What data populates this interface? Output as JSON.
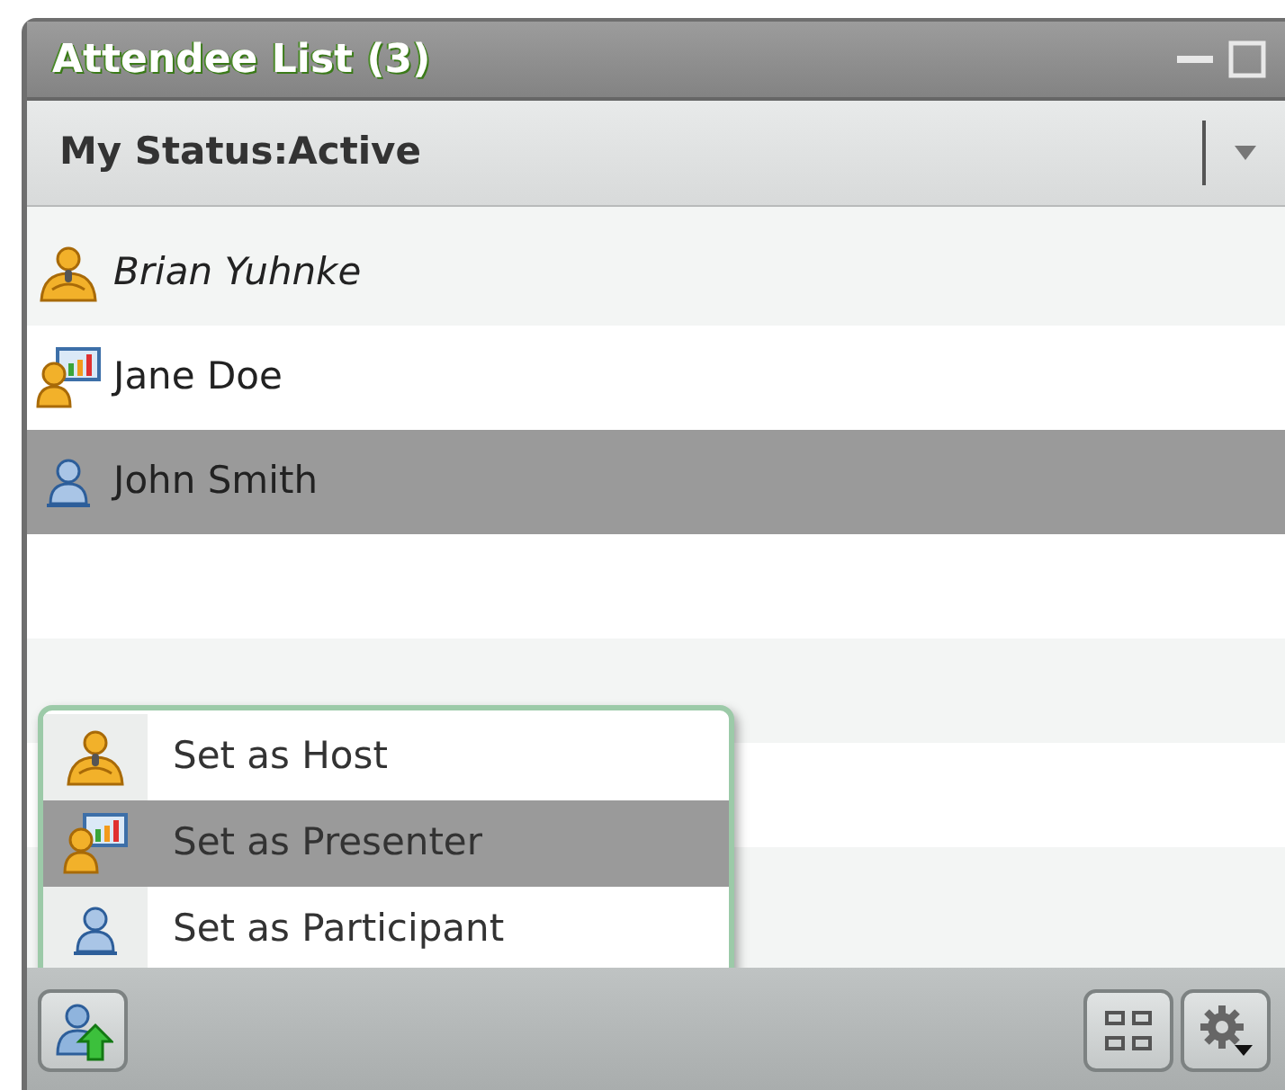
{
  "window": {
    "title": "Attendee List (3)"
  },
  "status": {
    "label": "My Status:Active"
  },
  "attendees": [
    {
      "name": "Brian Yuhnke",
      "kind": "host",
      "current_user": true,
      "selected": false
    },
    {
      "name": "Jane Doe",
      "kind": "presenter",
      "current_user": false,
      "selected": false
    },
    {
      "name": "John Smith",
      "kind": "participant",
      "current_user": false,
      "selected": true
    }
  ],
  "role_menu": [
    {
      "label": "Set as Host",
      "kind": "host",
      "selected": false
    },
    {
      "label": "Set as Presenter",
      "kind": "presenter",
      "selected": true
    },
    {
      "label": "Set as Participant",
      "kind": "participant",
      "selected": false
    }
  ]
}
